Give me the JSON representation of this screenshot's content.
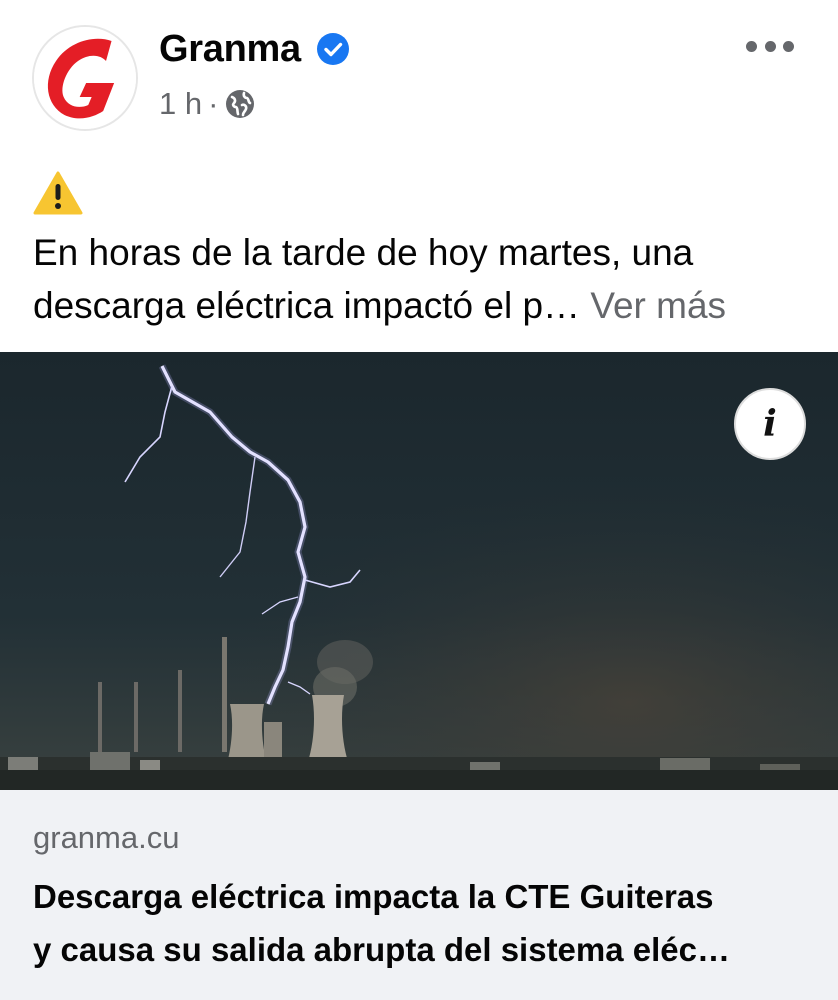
{
  "header": {
    "page_name": "Granma",
    "time": "1 h",
    "separator": "·",
    "avatar_icon": "granma-logo",
    "verified_icon": "verified-badge-icon",
    "privacy_icon": "globe-icon",
    "more_icon": "more-options-icon"
  },
  "post": {
    "warning_icon": "⚠️",
    "text_line1": "En horas de la tarde de hoy martes, una",
    "text_line2": "descarga eléctrica impactó el p…",
    "see_more": "Ver más"
  },
  "media": {
    "info_label": "i"
  },
  "link_preview": {
    "domain": "granma.cu",
    "title_line1": "Descarga eléctrica impacta la CTE Guiteras",
    "title_line2": "y causa su salida abrupta del sistema eléc…"
  },
  "colors": {
    "brand_red": "#e41e26",
    "verified_blue": "#1877f2",
    "secondary_text": "#65676b",
    "card_background": "#f0f2f5"
  }
}
